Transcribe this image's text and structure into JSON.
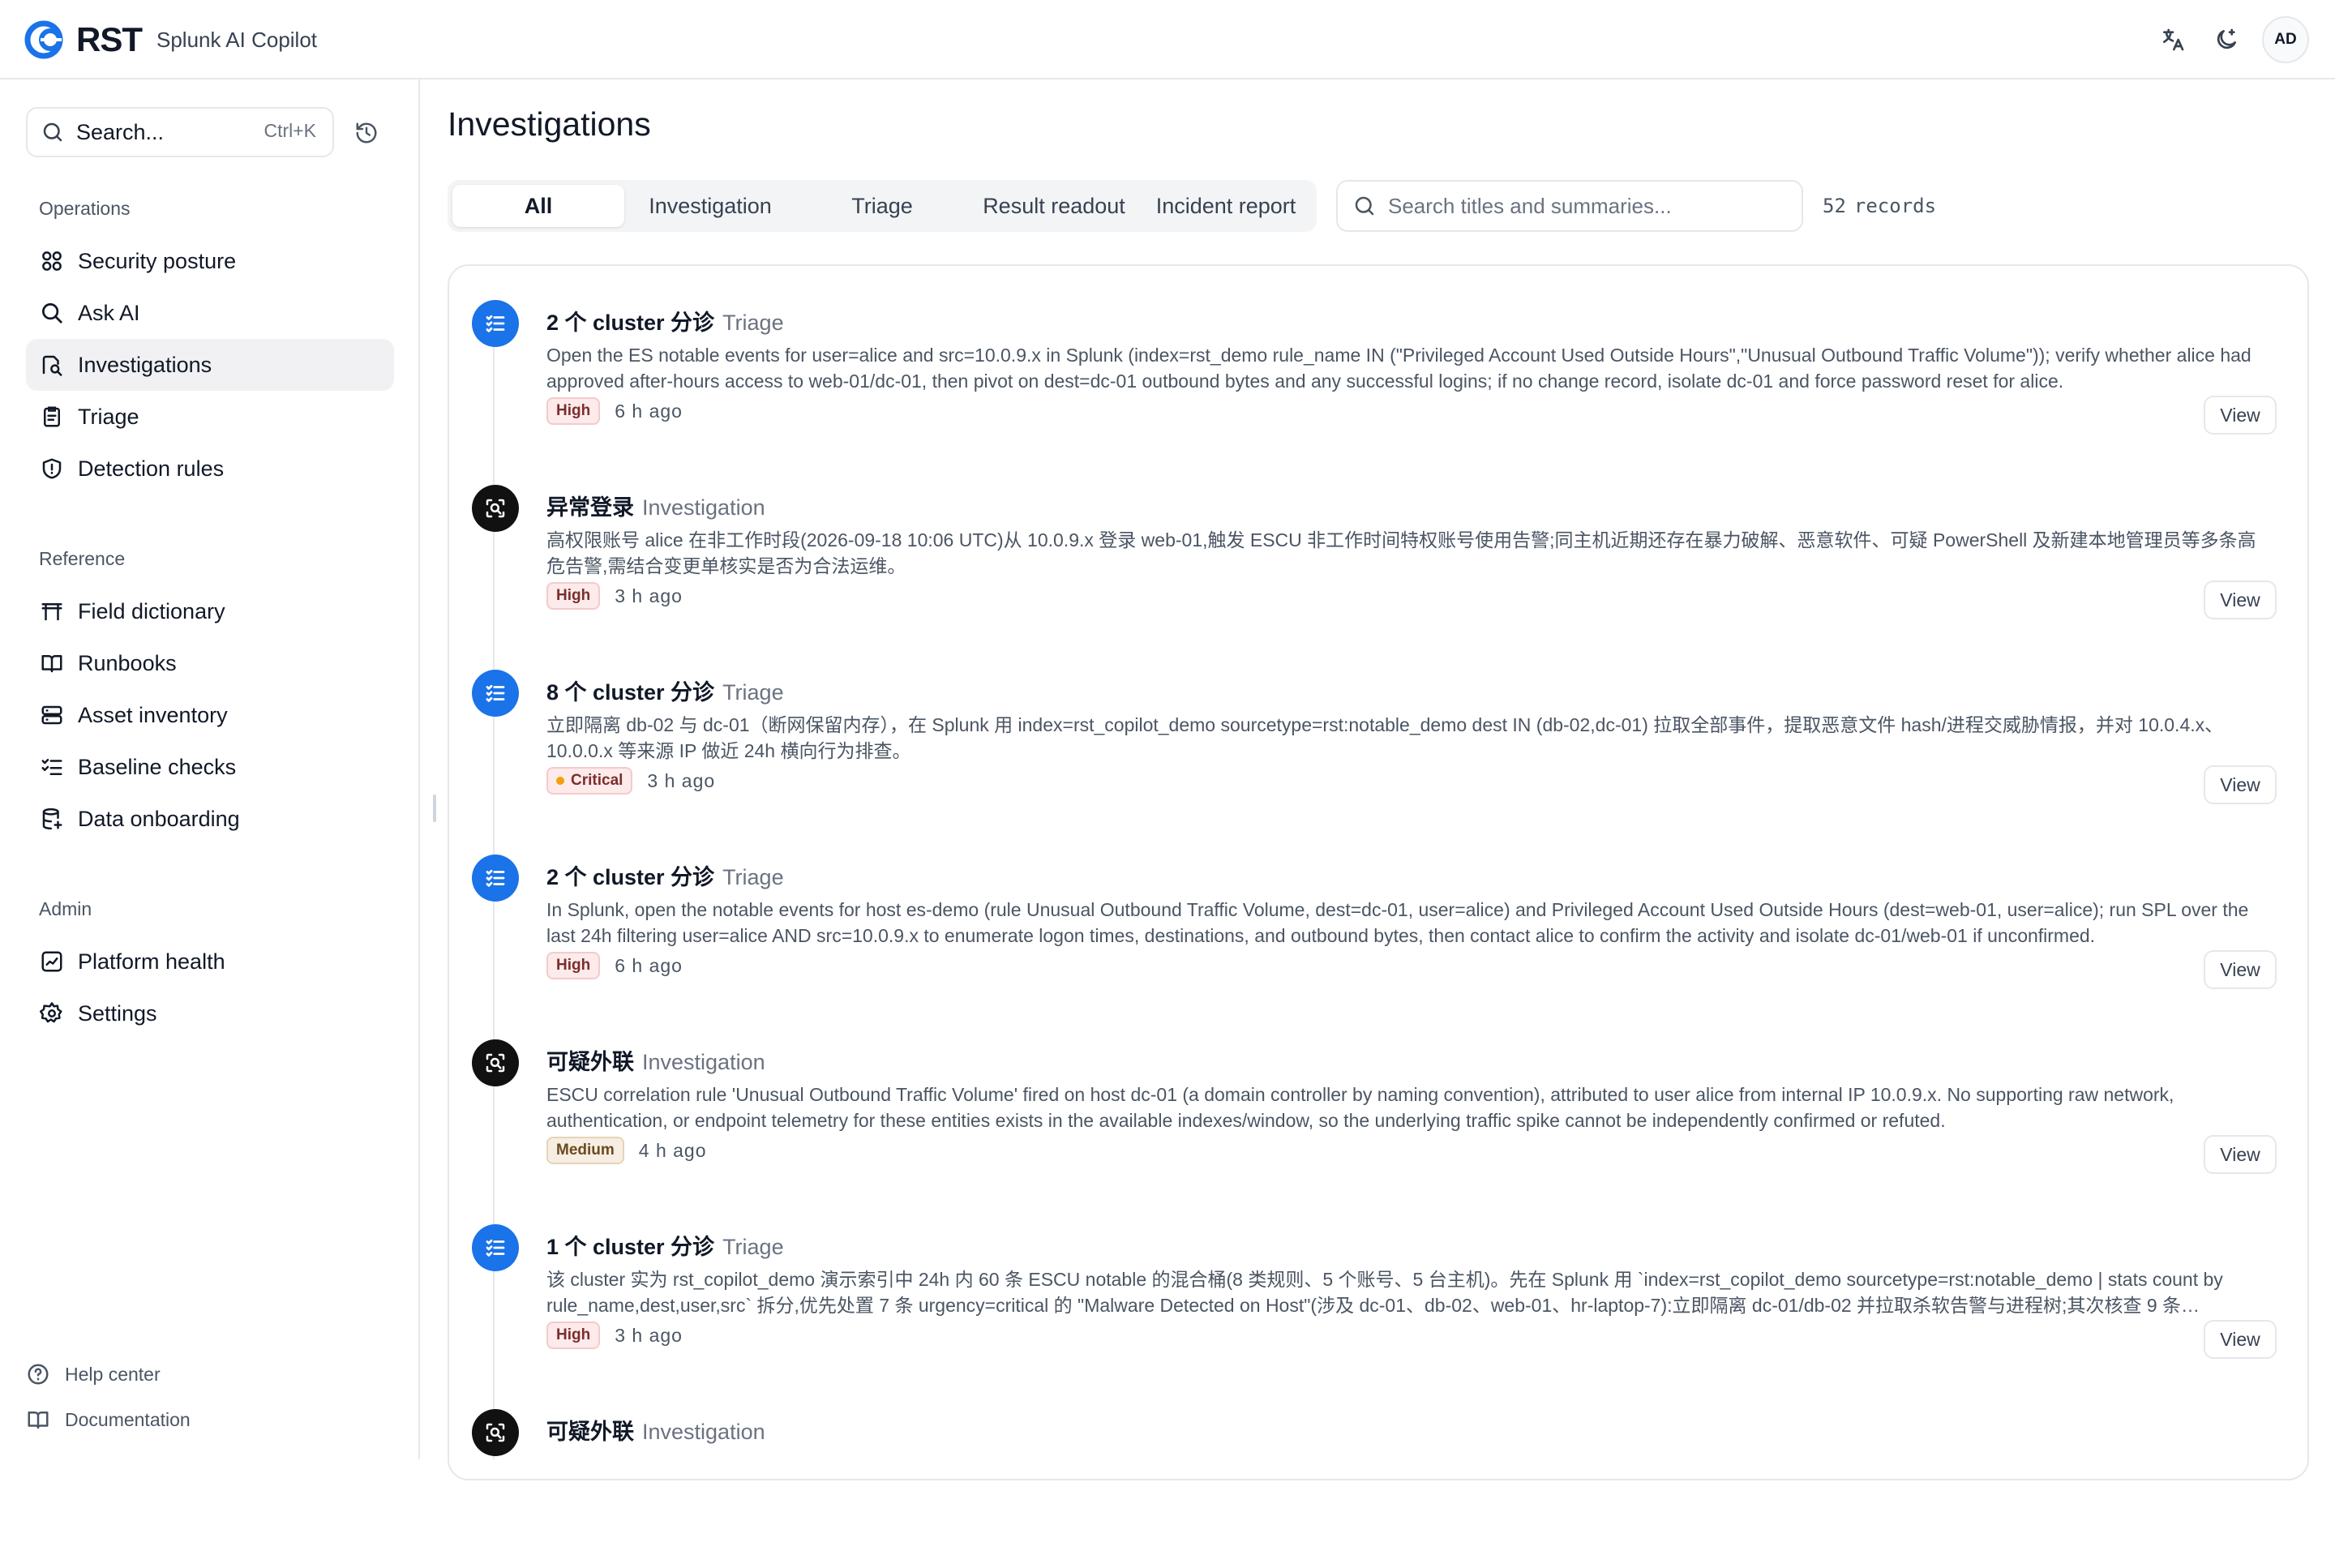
{
  "app": {
    "brand": "RST",
    "subtitle": "Splunk AI Copilot",
    "avatar": "AD"
  },
  "sidebar": {
    "search_placeholder": "Search...",
    "search_shortcut": "Ctrl+K",
    "sections": [
      {
        "label": "Operations",
        "items": [
          {
            "label": "Security posture",
            "icon": "grid-icon"
          },
          {
            "label": "Ask AI",
            "icon": "search-icon"
          },
          {
            "label": "Investigations",
            "icon": "investigation-icon",
            "active": true
          },
          {
            "label": "Triage",
            "icon": "clipboard-icon"
          },
          {
            "label": "Detection rules",
            "icon": "shield-alert-icon"
          }
        ]
      },
      {
        "label": "Reference",
        "items": [
          {
            "label": "Field dictionary",
            "icon": "table-icon"
          },
          {
            "label": "Runbooks",
            "icon": "book-open-icon"
          },
          {
            "label": "Asset inventory",
            "icon": "server-icon"
          },
          {
            "label": "Baseline checks",
            "icon": "checklist-icon"
          },
          {
            "label": "Data onboarding",
            "icon": "database-icon"
          }
        ]
      },
      {
        "label": "Admin",
        "items": [
          {
            "label": "Platform health",
            "icon": "activity-icon"
          },
          {
            "label": "Settings",
            "icon": "gear-icon"
          }
        ]
      }
    ],
    "footer": [
      {
        "label": "Help center",
        "icon": "help-circle-icon"
      },
      {
        "label": "Documentation",
        "icon": "book-icon"
      }
    ]
  },
  "main": {
    "title": "Investigations",
    "tabs": [
      {
        "label": "All",
        "active": true
      },
      {
        "label": "Investigation"
      },
      {
        "label": "Triage"
      },
      {
        "label": "Result readout"
      },
      {
        "label": "Incident report"
      }
    ],
    "search_placeholder": "Search titles and summaries...",
    "records_count": "52",
    "records_label": "records",
    "view_label": "View",
    "entries": [
      {
        "type": "triage",
        "title": "2 个 cluster 分诊",
        "kind": "Triage",
        "summary": "Open the ES notable events for user=alice and src=10.0.9.x in Splunk (index=rst_demo rule_name IN (\"Privileged Account Used Outside Hours\",\"Unusual Outbound Traffic Volume\")); verify whether alice had approved after-hours access to web-01/dc-01, then pivot on dest=dc-01 outbound bytes and any successful logins; if no change record, isolate dc-01 and force password reset for alice.",
        "severity": "High",
        "severity_class": "high",
        "time": "6  h  ago"
      },
      {
        "type": "investigation",
        "title": "异常登录",
        "kind": "Investigation",
        "summary": "高权限账号 alice 在非工作时段(2026-09-18 10:06 UTC)从 10.0.9.x 登录 web-01,触发 ESCU 非工作时间特权账号使用告警;同主机近期还存在暴力破解、恶意软件、可疑 PowerShell 及新建本地管理员等多条高危告警,需结合变更单核实是否为合法运维。",
        "severity": "High",
        "severity_class": "high",
        "time": "3  h  ago"
      },
      {
        "type": "triage",
        "title": "8 个 cluster 分诊",
        "kind": "Triage",
        "summary": "立即隔离 db-02 与 dc-01（断网保留内存），在 Splunk 用 index=rst_copilot_demo sourcetype=rst:notable_demo dest IN (db-02,dc-01) 拉取全部事件，提取恶意文件 hash/进程交威胁情报，并对 10.0.4.x、10.0.0.x 等来源 IP 做近 24h 横向行为排查。",
        "severity": "Critical",
        "severity_class": "critical",
        "time": "3  h  ago"
      },
      {
        "type": "triage",
        "title": "2 个 cluster 分诊",
        "kind": "Triage",
        "summary": "In Splunk, open the notable events for host es-demo (rule Unusual Outbound Traffic Volume, dest=dc-01, user=alice) and Privileged Account Used Outside Hours (dest=web-01, user=alice); run SPL over the last 24h filtering user=alice AND src=10.0.9.x to enumerate logon times, destinations, and outbound bytes, then contact alice to confirm the activity and isolate dc-01/web-01 if unconfirmed.",
        "severity": "High",
        "severity_class": "high",
        "time": "6  h  ago"
      },
      {
        "type": "investigation",
        "title": "可疑外联",
        "kind": "Investigation",
        "summary": "ESCU correlation rule 'Unusual Outbound Traffic Volume' fired on host dc-01 (a domain controller by naming convention), attributed to user alice from internal IP 10.0.9.x. No supporting raw network, authentication, or endpoint telemetry for these entities exists in the available indexes/window, so the underlying traffic spike cannot be independently confirmed or refuted.",
        "severity": "Medium",
        "severity_class": "medium",
        "time": "4  h  ago"
      },
      {
        "type": "triage",
        "title": "1 个 cluster 分诊",
        "kind": "Triage",
        "summary": "该 cluster 实为 rst_copilot_demo 演示索引中 24h 内 60 条 ESCU notable 的混合桶(8 类规则、5 个账号、5 台主机)。先在 Splunk 用 `index=rst_copilot_demo sourcetype=rst:notable_demo | stats count by rule_name,dest,user,src` 拆分,优先处置 7 条 urgency=critical 的 \"Malware Detected on Host\"(涉及 dc-01、db-02、web-01、hr-laptop-7):立即隔离 dc-01/db-02 并拉取杀软告警与进程树;其次核查 9 条…",
        "severity": "High",
        "severity_class": "high",
        "time": "3  h  ago"
      },
      {
        "type": "investigation",
        "title": "可疑外联",
        "kind": "Investigation",
        "summary": "",
        "severity": "",
        "severity_class": "",
        "time": ""
      }
    ]
  }
}
